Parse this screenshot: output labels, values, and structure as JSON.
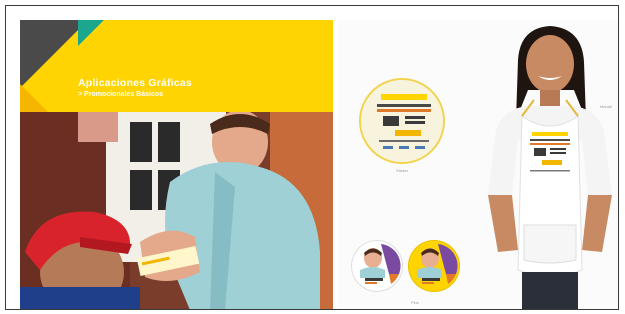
{
  "section": {
    "title": "Aplicaciones Gráficas",
    "subtitle": "> Promocionales Básicos"
  },
  "item_labels": {
    "sticker": "Sticker",
    "apron": "Mandil",
    "pins": "Pins"
  },
  "colors": {
    "brand_yellow": "#ffd400",
    "teal_accent": "#1aa78e",
    "dark_grey": "#4a4a4a",
    "cap_red": "#d9232c"
  }
}
